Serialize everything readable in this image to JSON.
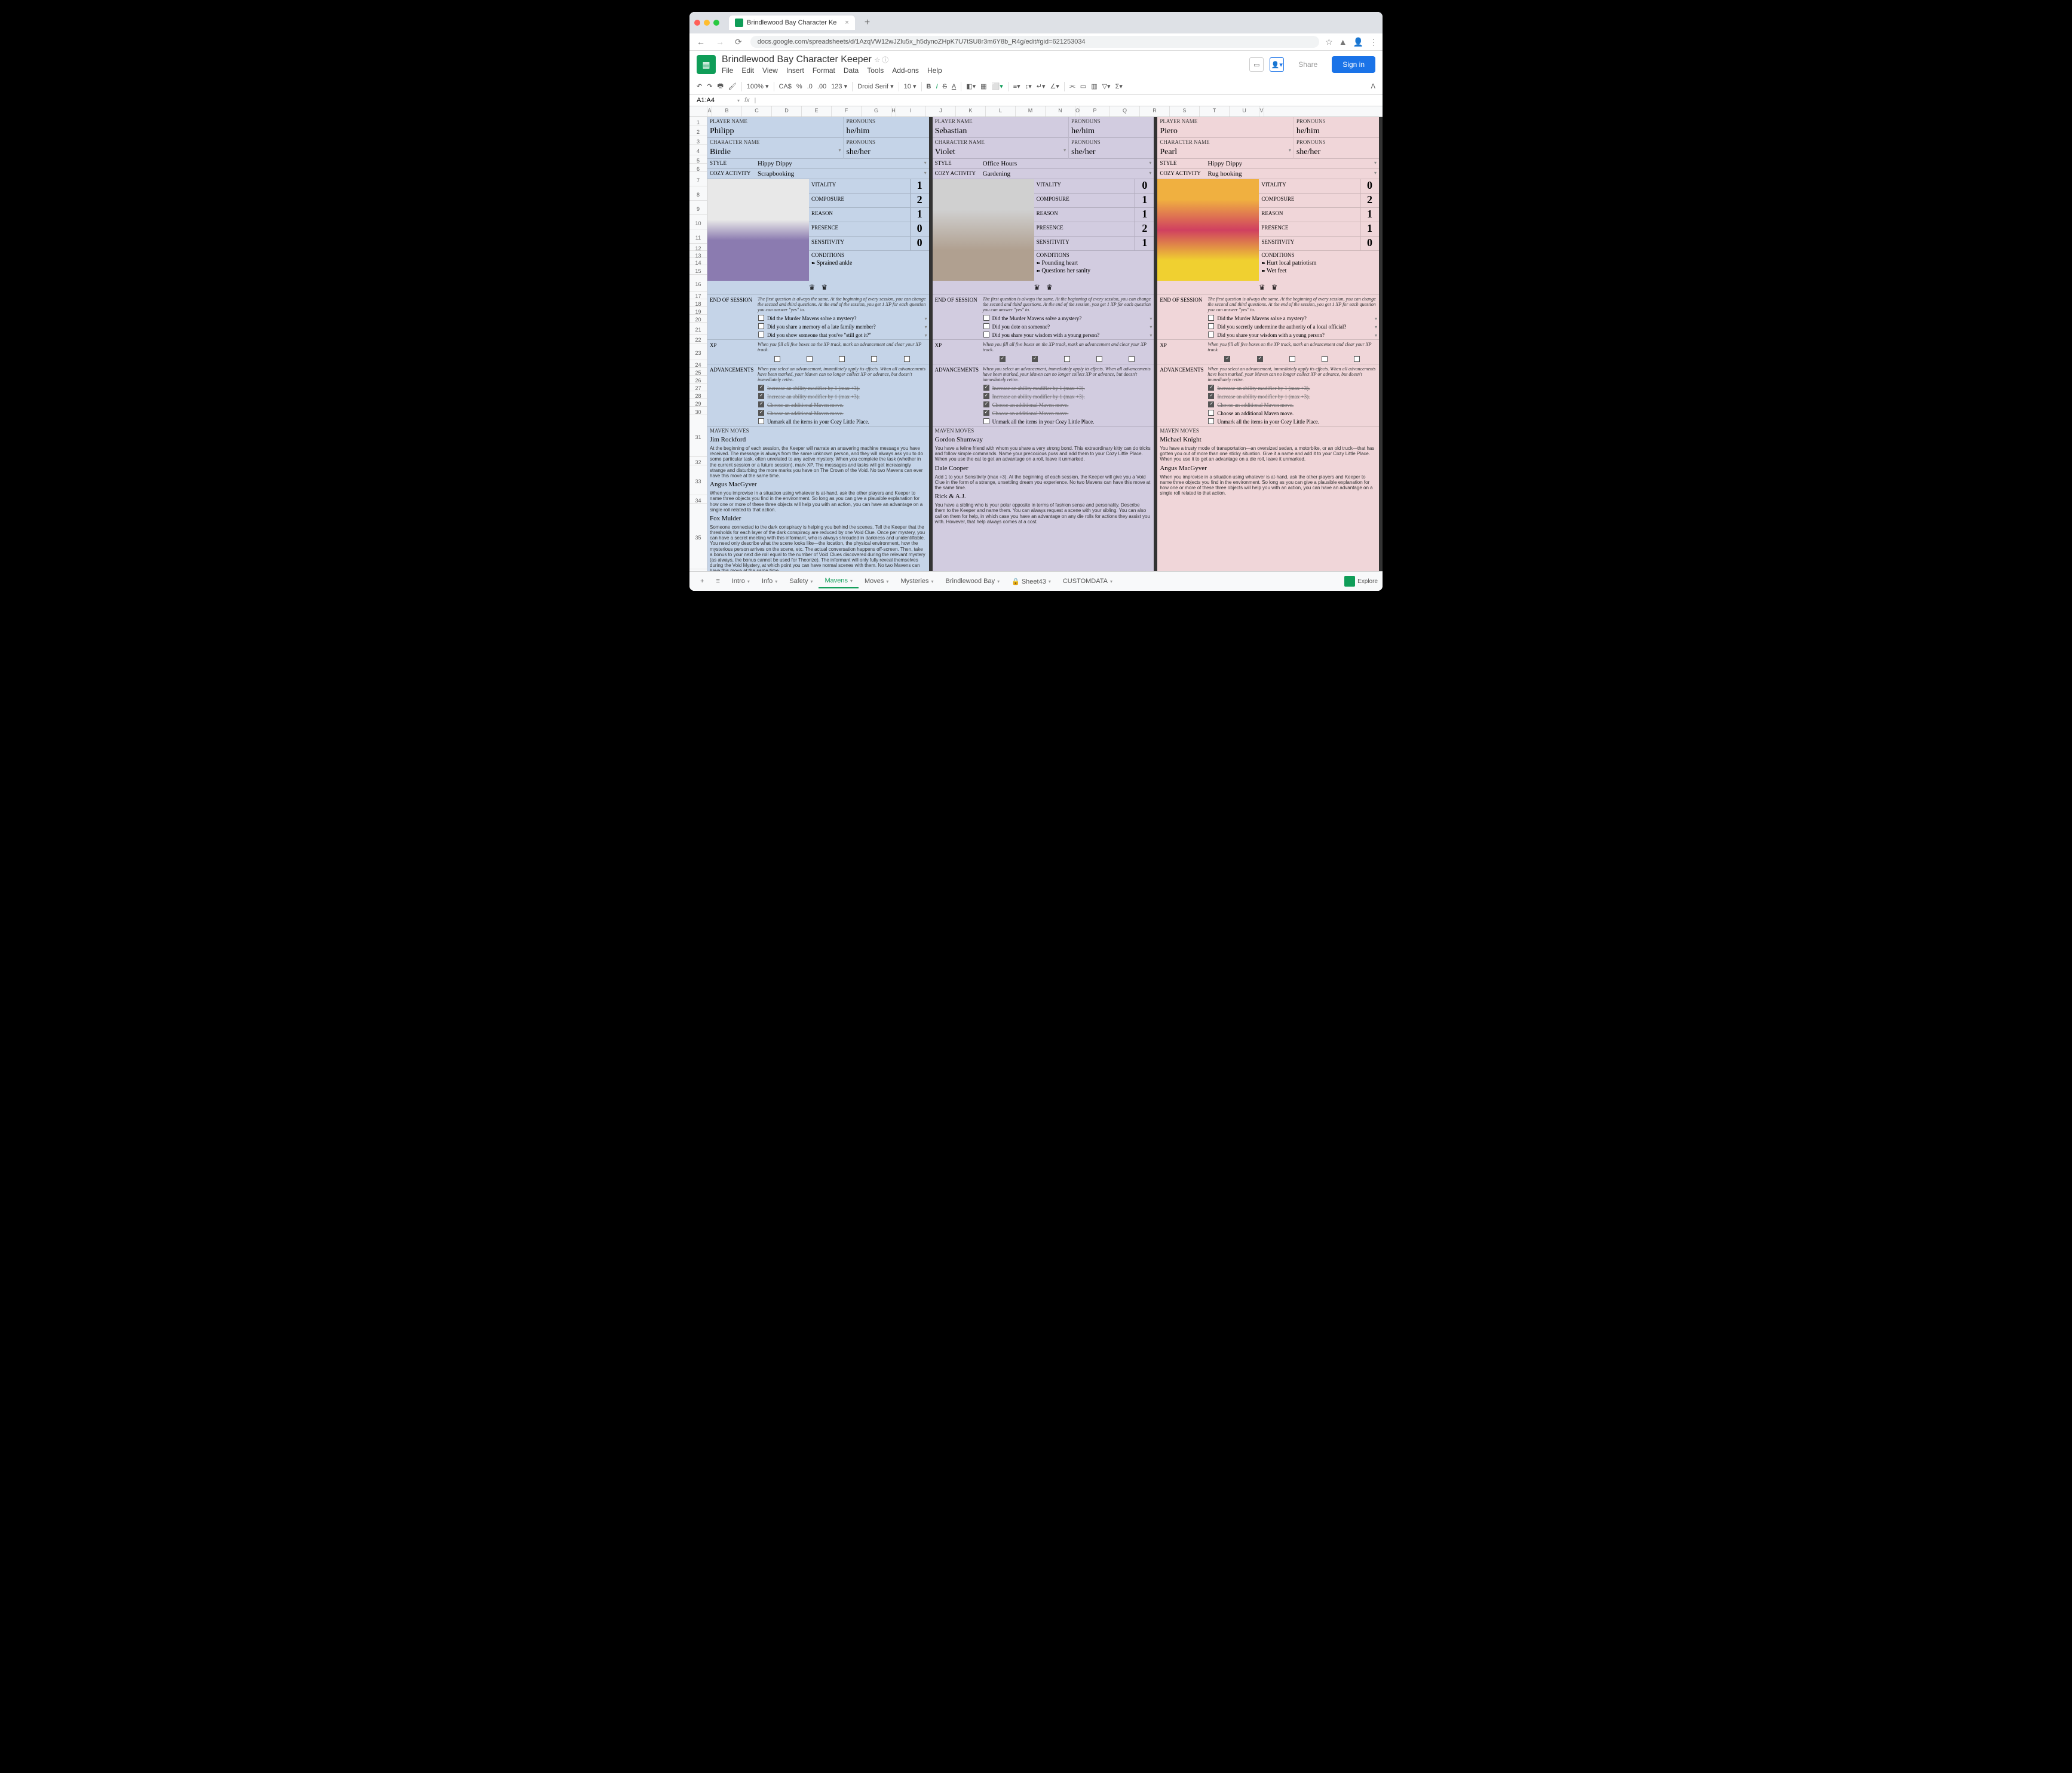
{
  "browser": {
    "tab_title": "Brindlewood Bay Character Ke",
    "url": "docs.google.com/spreadsheets/d/1AzqVW12wJZlu5x_h5dynoZHpK7U7tSU8r3m6Y8b_R4g/edit#gid=621253034"
  },
  "app": {
    "doc_title": "Brindlewood Bay Character Keeper",
    "menus": [
      "File",
      "Edit",
      "View",
      "Insert",
      "Format",
      "Data",
      "Tools",
      "Add-ons",
      "Help"
    ],
    "share": "Share",
    "signin": "Sign in"
  },
  "toolbar": {
    "zoom": "100%",
    "currency": "CA$",
    "pct": "%",
    "dec1": ".0",
    "dec2": ".00",
    "fmt": "123",
    "font": "Droid Serif",
    "size": "10"
  },
  "cell_ref": "A1:A4",
  "col_headers": [
    "A",
    "B",
    "C",
    "D",
    "E",
    "F",
    "G",
    "H",
    "I",
    "J",
    "K",
    "L",
    "M",
    "N",
    "O",
    "P",
    "Q",
    "R",
    "S",
    "T",
    "U",
    "V"
  ],
  "row_numbers": [
    "1",
    "2",
    "3",
    "4",
    "5",
    "6",
    "7",
    "8",
    "9",
    "10",
    "11",
    "12",
    "13",
    "14",
    "15",
    "16",
    "17",
    "18",
    "19",
    "20",
    "21",
    "22",
    "23",
    "24",
    "25",
    "26",
    "27",
    "28",
    "29",
    "30",
    "31",
    "32",
    "33",
    "34",
    "35"
  ],
  "labels": {
    "player_name": "PLAYER NAME",
    "pronouns": "PRONOUNS",
    "character_name": "CHARACTER NAME",
    "style": "STYLE",
    "cozy": "COZY ACTIVITY",
    "vitality": "VITALITY",
    "composure": "COMPOSURE",
    "reason": "REASON",
    "presence": "PRESENCE",
    "sensitivity": "SENSITIVITY",
    "conditions": "CONDITIONS",
    "eos": "END OF SESSION",
    "xp": "XP",
    "adv": "ADVANCEMENTS",
    "mm": "MAVEN MOVES"
  },
  "help": {
    "eos": "The first question is always the same. At the beginning of every session, you can change the second and third questions. At the end of the session, you get 1 XP for each question you can answer \"yes\" to.",
    "xp": "When you fill all five boxes on the XP track, mark an advancement and clear your XP track.",
    "adv": "When you select an advancement, immediately apply its effects. When all advancements have been marked, your Maven can no longer collect XP or advance, but doesn't immediately retire."
  },
  "adv_options": [
    "Increase an ability modifier by 1 (max +3).",
    "Increase an ability modifier by 1 (max +3).",
    "Choose an additional Maven move.",
    "Choose an additional Maven move.",
    "Unmark all the items in your Cozy Little Place."
  ],
  "characters": [
    {
      "player": "Philipp",
      "player_pronouns": "he/him",
      "name": "Birdie",
      "pronouns": "she/her",
      "style": "Hippy Dippy",
      "cozy": "Scrapbooking",
      "stats": {
        "vitality": "1",
        "composure": "2",
        "reason": "1",
        "presence": "0",
        "sensitivity": "0"
      },
      "conditions": [
        "Sprained ankle"
      ],
      "questions": [
        "Did the Murder Mavens solve a mystery?",
        "Did you share a memory of a late family member?",
        "Did you show someone that you've \"still got it?\""
      ],
      "xp_checked": [
        false,
        false,
        false,
        false,
        false
      ],
      "adv_checked": [
        true,
        true,
        true,
        true,
        false
      ],
      "moves": [
        {
          "name": "Jim Rockford",
          "desc": "At the beginning of each session, the Keeper will narrate an answering machine message you have received. The message is always from the same unknown person, and they will always ask you to do some particular task, often unrelated to any active mystery. When you complete the task (whether in the current session or a future session), mark XP. The messages and tasks will get increasingly strange and disturbing the more marks you have on The Crown of the Void. No two Mavens can ever have this move at the same time."
        },
        {
          "name": "Angus MacGyver",
          "desc": "When you improvise in a situation using whatever is at-hand, ask the other players and Keeper to name three objects you find in the environment. So long as you can give a plausible explanation for how one or more of these three objects will help you with an action, you can have an advantage on a single roll related to that action."
        },
        {
          "name": "Fox Mulder",
          "desc": "Someone connected to the dark conspiracy is helping you behind the scenes. Tell the Keeper that the thresholds for each layer of the dark conspiracy are reduced by one Void Clue. Once per mystery, you can have a secret meeting with this informant, who is always shrouded in darkness and unidentifiable. You need only describe what the scene looks like—the location, the physical environment, how the mysterious person arrives on the scene, etc. The actual conversation happens off-screen. Then, take a bonus to your next die roll equal to the number of Void Clues discovered during the relevant mystery (as always, the bonus cannot be used for Theorize). The informant will only fully reveal themselves during the Void Mystery, at which point you can have normal scenes with them. No two Mavens can have this move at the same time."
        }
      ]
    },
    {
      "player": "Sebastian",
      "player_pronouns": "he/him",
      "name": "Violet",
      "pronouns": "she/her",
      "style": "Office Hours",
      "cozy": "Gardening",
      "stats": {
        "vitality": "0",
        "composure": "1",
        "reason": "1",
        "presence": "2",
        "sensitivity": "1"
      },
      "conditions": [
        "Pounding heart",
        "Questions her sanity"
      ],
      "questions": [
        "Did the Murder Mavens solve a mystery?",
        "Did you dote on someone?",
        "Did you share your wisdom with a young person?"
      ],
      "xp_checked": [
        true,
        true,
        false,
        false,
        false
      ],
      "adv_checked": [
        true,
        true,
        true,
        true,
        false
      ],
      "moves": [
        {
          "name": "Gordon Shumway",
          "desc": "You have a feline friend with whom you share a very strong bond. This extraordinary kitty can do tricks and follow simple commands. Name your precocious puss and add them to your Cozy Little Place. When you use the cat to get an advantage on a roll, leave it unmarked."
        },
        {
          "name": "Dale Cooper",
          "desc": "Add 1 to your Sensitivity (max +3). At the beginning of each session, the Keeper will give you a Void Clue in the form of a strange, unsettling dream you experience. No two Mavens can have this move at the same time."
        },
        {
          "name": "Rick & A.J.",
          "desc": "You have a sibling who is your polar opposite in terms of fashion sense and personality. Describe them to the Keeper and name them. You can always request a scene with your sibling. You can also call on them for help, in which case you have an advantage on any die rolls for actions they assist you with. However, that help always comes at a cost."
        }
      ]
    },
    {
      "player": "Piero",
      "player_pronouns": "he/him",
      "name": "Pearl",
      "pronouns": "she/her",
      "style": "Hippy Dippy",
      "cozy": "Rug hooking",
      "stats": {
        "vitality": "0",
        "composure": "2",
        "reason": "1",
        "presence": "1",
        "sensitivity": "0"
      },
      "conditions": [
        "Hurt local patriotism",
        "Wet feet"
      ],
      "questions": [
        "Did the Murder Mavens solve a mystery?",
        "Did you secretly undermine the authority of a local official?",
        "Did you share your wisdom with a young person?"
      ],
      "xp_checked": [
        true,
        true,
        false,
        false,
        false
      ],
      "adv_checked": [
        true,
        true,
        true,
        false,
        false
      ],
      "moves": [
        {
          "name": "Michael Knight",
          "desc": "You have a trusty mode of transportation—an oversized sedan, a motorbike, or an old truck—that has gotten you out of more than one sticky situation. Give it a name and add it to your Cozy Little Place. When you use it to get an advantage on a die roll, leave it unmarked."
        },
        {
          "name": "Angus MacGyver",
          "desc": "When you improvise in a situation using whatever is at-hand, ask the other players and Keeper to name three objects you find in the environment. So long as you can give a plausible explanation for how one or more of these three objects will help you with an action, you can have an advantage on a single roll related to that action."
        }
      ]
    }
  ],
  "sheet_tabs": [
    "Intro",
    "Info",
    "Safety",
    "Mavens",
    "Moves",
    "Mysteries",
    "Brindlewood Bay",
    "Sheet43",
    "CUSTOMDATA"
  ],
  "active_tab": "Mavens",
  "explore": "Explore"
}
